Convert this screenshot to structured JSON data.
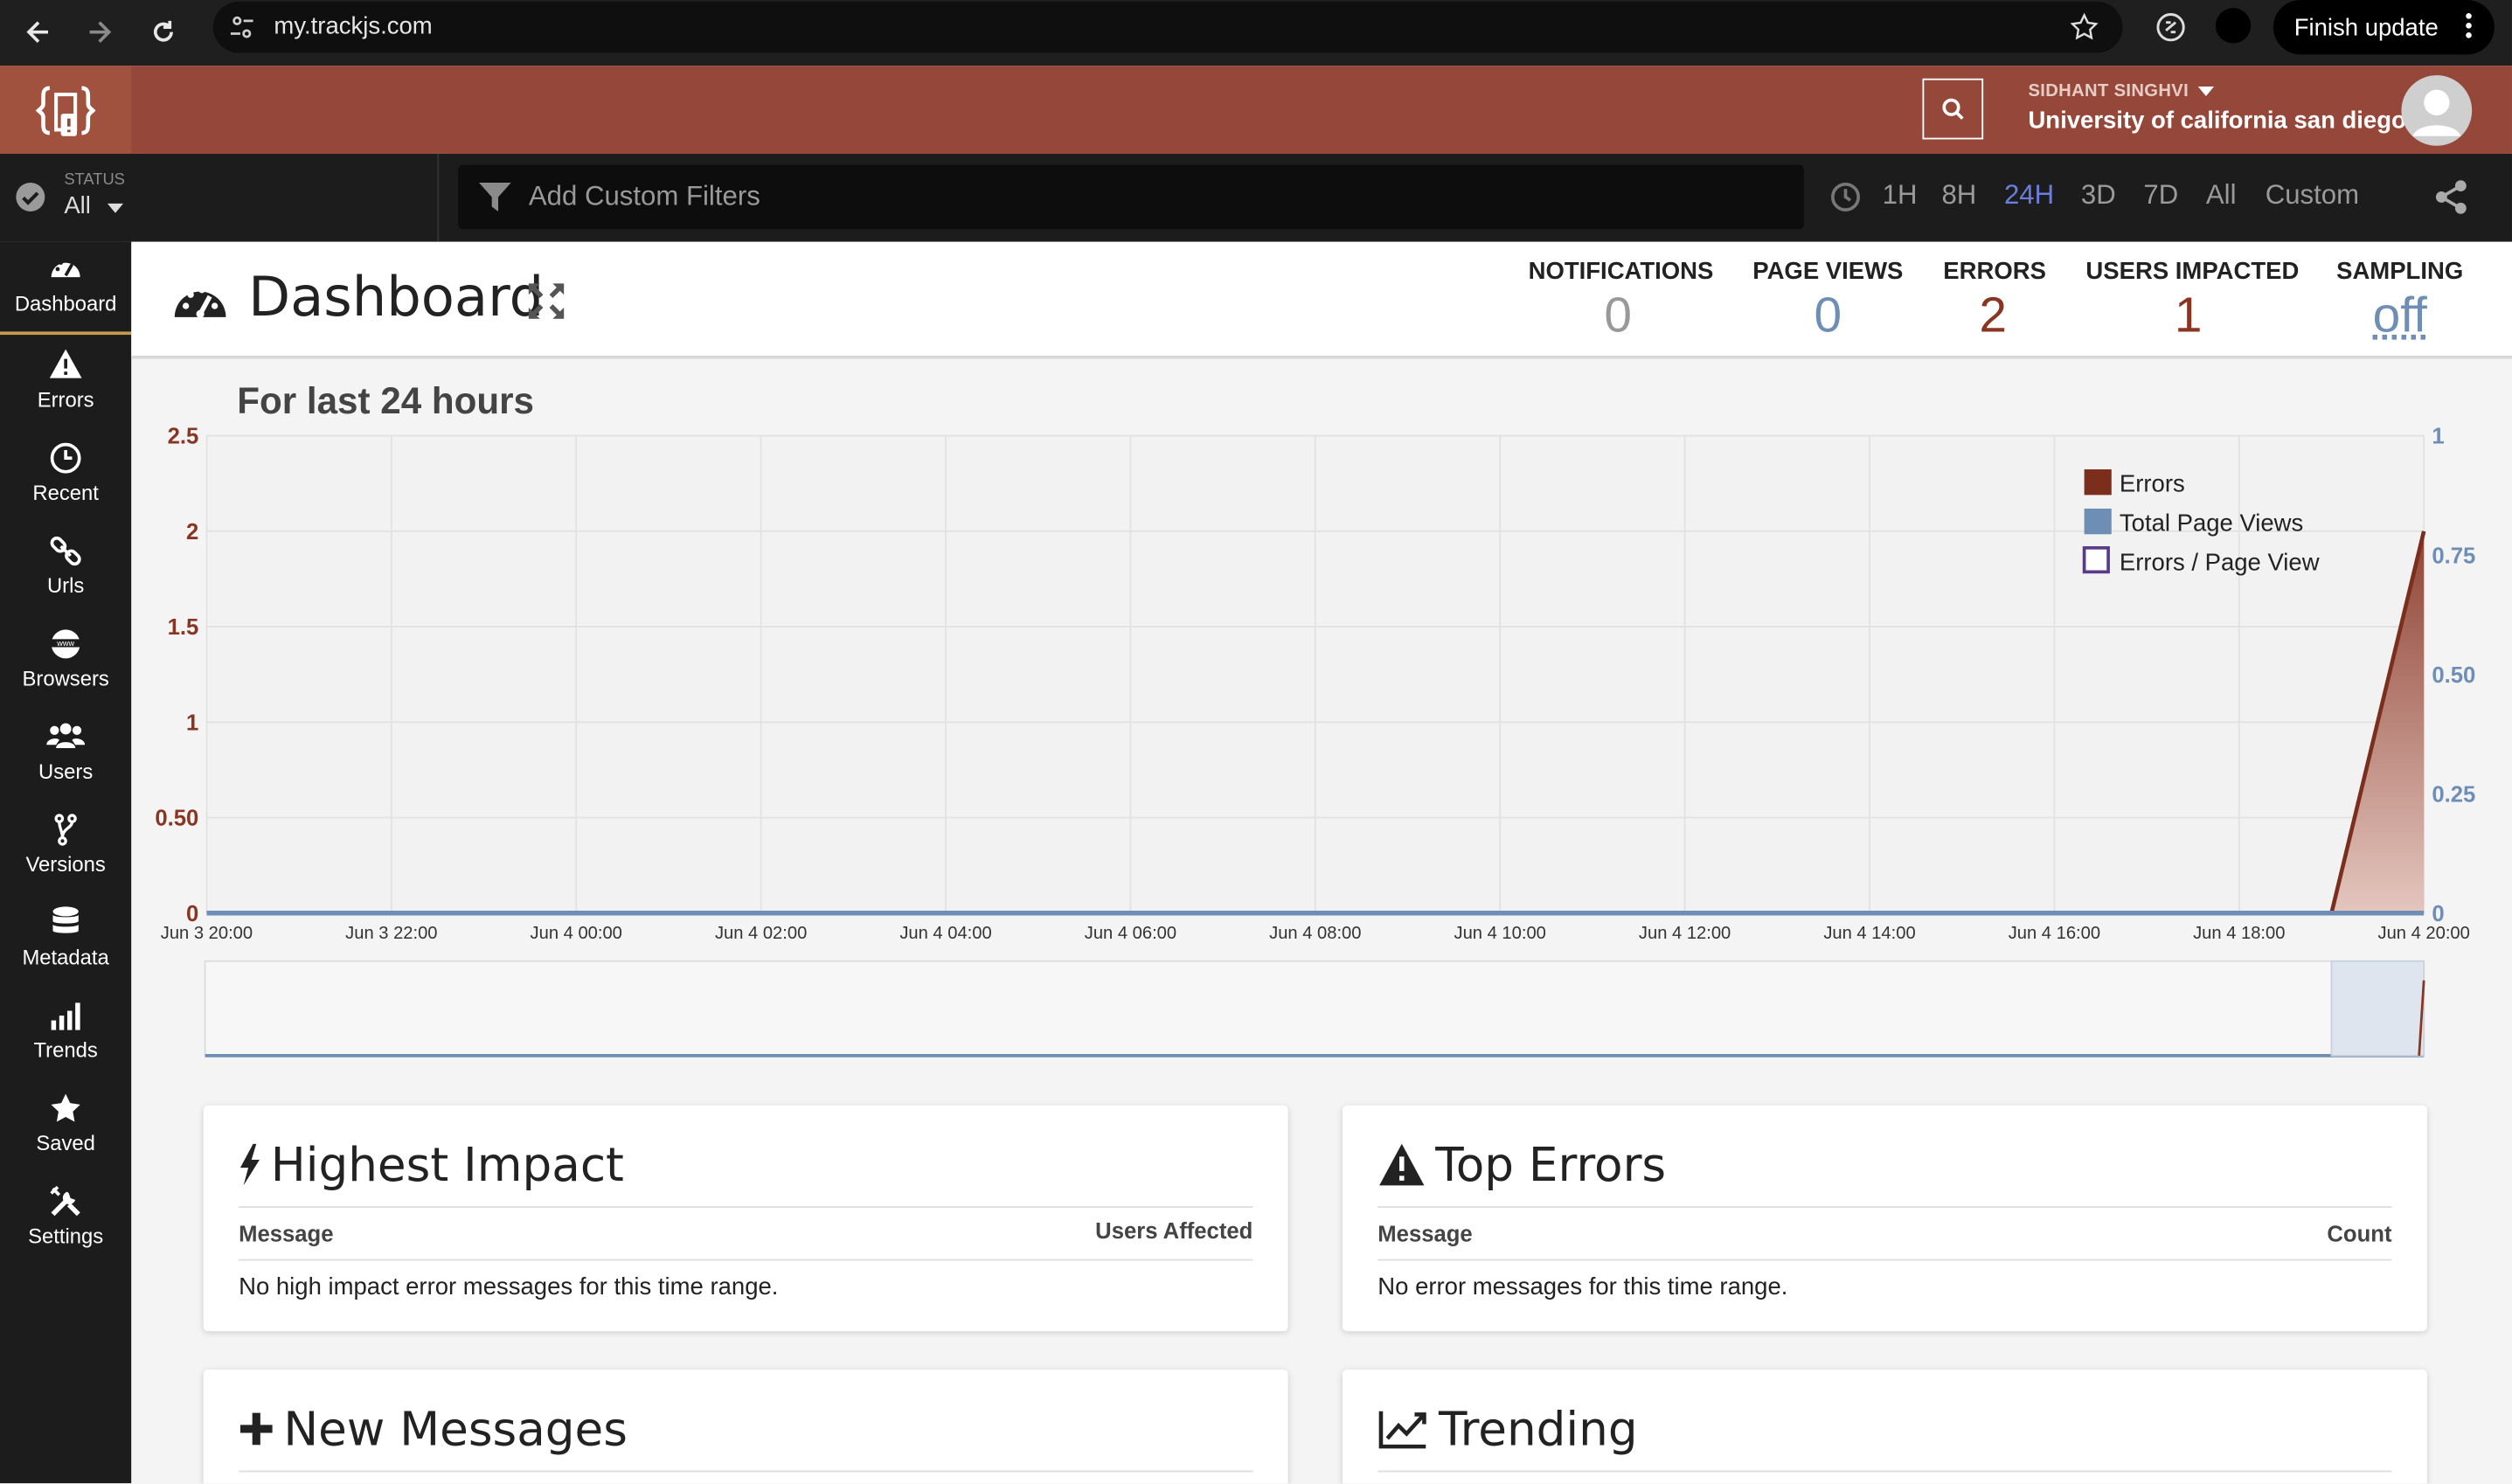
{
  "browser": {
    "url": "my.trackjs.com",
    "finish_update": "Finish update"
  },
  "header": {
    "user_name": "SIDHANT SINGHVI",
    "org": "University of california san diego"
  },
  "filters": {
    "status_label": "STATUS",
    "status_value": "All",
    "custom_placeholder": "Add Custom Filters",
    "ranges": [
      "1H",
      "8H",
      "24H",
      "3D",
      "7D",
      "All",
      "Custom"
    ],
    "active_range": "24H"
  },
  "sidebar": {
    "items": [
      {
        "label": "Dashboard",
        "icon": "dashboard-icon"
      },
      {
        "label": "Errors",
        "icon": "warning-icon"
      },
      {
        "label": "Recent",
        "icon": "clock-icon"
      },
      {
        "label": "Urls",
        "icon": "link-icon"
      },
      {
        "label": "Browsers",
        "icon": "www-icon"
      },
      {
        "label": "Users",
        "icon": "users-icon"
      },
      {
        "label": "Versions",
        "icon": "branch-icon"
      },
      {
        "label": "Metadata",
        "icon": "database-icon"
      },
      {
        "label": "Trends",
        "icon": "bars-icon"
      },
      {
        "label": "Saved",
        "icon": "star-icon"
      },
      {
        "label": "Settings",
        "icon": "tools-icon"
      }
    ]
  },
  "dashboard": {
    "title": "Dashboard",
    "stats": [
      {
        "label": "NOTIFICATIONS",
        "value": "0",
        "color": "#999999"
      },
      {
        "label": "PAGE VIEWS",
        "value": "0",
        "color": "#6e8eb5"
      },
      {
        "label": "ERRORS",
        "value": "2",
        "color": "#8a3522"
      },
      {
        "label": "USERS IMPACTED",
        "value": "1",
        "color": "#8a3522"
      },
      {
        "label": "SAMPLING",
        "value": "off",
        "color": "#6e8eb5"
      }
    ],
    "chart_heading": "For last 24 hours"
  },
  "chart_data": {
    "type": "area",
    "x": [
      "Jun 3 20:00",
      "Jun 3 22:00",
      "Jun 4 00:00",
      "Jun 4 02:00",
      "Jun 4 04:00",
      "Jun 4 06:00",
      "Jun 4 08:00",
      "Jun 4 10:00",
      "Jun 4 12:00",
      "Jun 4 14:00",
      "Jun 4 16:00",
      "Jun 4 18:00",
      "Jun 4 20:00"
    ],
    "y_left_ticks": [
      "0",
      "0.50",
      "1",
      "1.5",
      "2",
      "2.5"
    ],
    "y_right_ticks": [
      "0",
      "0.25",
      "0.50",
      "0.75",
      "1"
    ],
    "ylim_left": [
      0,
      2.5
    ],
    "ylim_right": [
      0,
      1
    ],
    "grid": true,
    "legend_position": "top-right",
    "series": [
      {
        "name": "Errors",
        "color": "#7a2e1b",
        "axis": "left",
        "points": [
          [
            "Jun 4 19:00",
            0
          ],
          [
            "Jun 4 20:00",
            2
          ]
        ]
      },
      {
        "name": "Total Page Views",
        "color": "#6e8eb5",
        "axis": "right",
        "points": [
          [
            "Jun 3 20:00",
            0
          ],
          [
            "Jun 4 20:00",
            0
          ]
        ]
      },
      {
        "name": "Errors / Page View",
        "color": "#5a3a8a",
        "axis": "right",
        "points": []
      }
    ]
  },
  "panels": {
    "highest_impact": {
      "title": "Highest Impact",
      "col_left": "Message",
      "col_right": "Users Affected",
      "empty": "No high impact error messages for this time range."
    },
    "top_errors": {
      "title": "Top Errors",
      "col_left": "Message",
      "col_right": "Count",
      "empty": "No error messages for this time range."
    },
    "new_messages": {
      "title": "New Messages"
    },
    "trending": {
      "title": "Trending"
    }
  }
}
